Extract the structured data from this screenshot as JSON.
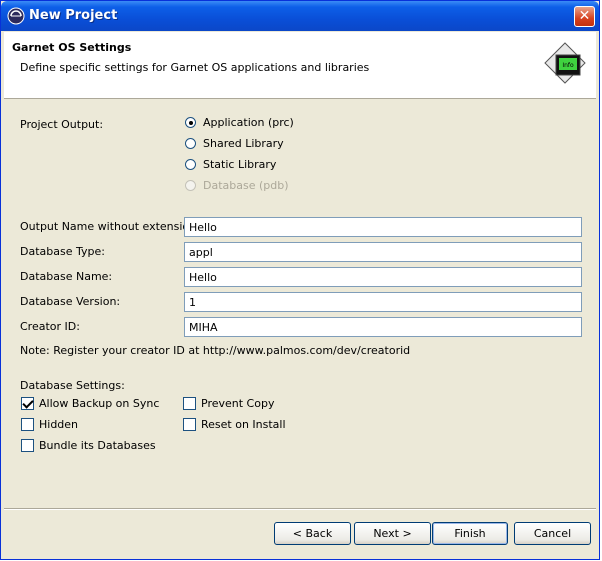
{
  "window": {
    "title": "New Project",
    "close_label": "✕"
  },
  "header": {
    "title": "Garnet OS Settings",
    "description": "Define specific settings for Garnet OS applications and libraries",
    "logo_text": "Info"
  },
  "project_output": {
    "label": "Project Output:",
    "options": [
      {
        "label": "Application (prc)",
        "checked": true,
        "enabled": true
      },
      {
        "label": "Shared Library",
        "checked": false,
        "enabled": true
      },
      {
        "label": "Static Library",
        "checked": false,
        "enabled": true
      },
      {
        "label": "Database (pdb)",
        "checked": false,
        "enabled": false
      }
    ]
  },
  "fields": {
    "output_name": {
      "label": "Output Name without extension:",
      "value": "Hello"
    },
    "database_type": {
      "label": "Database Type:",
      "value": "appl"
    },
    "database_name": {
      "label": "Database Name:",
      "value": "Hello"
    },
    "database_version": {
      "label": "Database Version:",
      "value": "1"
    },
    "creator_id": {
      "label": "Creator ID:",
      "value": "MIHA"
    }
  },
  "note": "Note: Register your creator ID at http://www.palmos.com/dev/creatorid",
  "database_settings": {
    "label": "Database Settings:",
    "allow_backup": {
      "label": "Allow Backup on Sync",
      "checked": true
    },
    "prevent_copy": {
      "label": "Prevent Copy",
      "checked": false
    },
    "hidden": {
      "label": "Hidden",
      "checked": false
    },
    "reset_on_install": {
      "label": "Reset on Install",
      "checked": false
    },
    "bundle": {
      "label": "Bundle its Databases",
      "checked": false
    }
  },
  "buttons": {
    "back": "< Back",
    "next": "Next >",
    "finish": "Finish",
    "cancel": "Cancel"
  },
  "colors": {
    "titlebar": "#0a4fd8",
    "dialog_bg": "#ece9d8",
    "close": "#d7411f"
  }
}
